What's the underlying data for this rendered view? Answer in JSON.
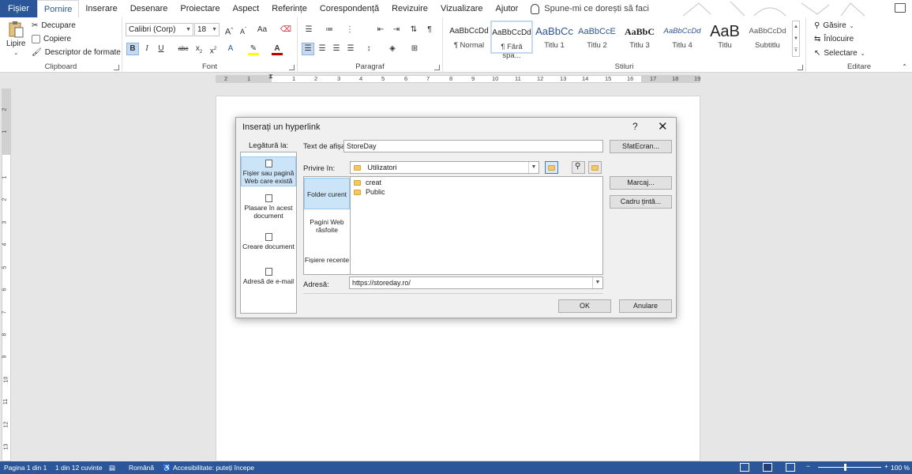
{
  "tabs": [
    "Fișier",
    "Pornire",
    "Inserare",
    "Desenare",
    "Proiectare",
    "Aspect",
    "Referințe",
    "Corespondență",
    "Revizuire",
    "Vizualizare",
    "Ajutor"
  ],
  "tell_me": "Spune-mi ce dorești să faci",
  "clipboard": {
    "paste": "Lipire",
    "cut": "Decupare",
    "copy": "Copiere",
    "format_painter": "Descriptor de formate",
    "label": "Clipboard"
  },
  "font": {
    "name": "Calibri (Corp)",
    "size": "18",
    "label": "Font",
    "case_button": "Aa",
    "grow": "A",
    "shrink": "A"
  },
  "paragraph": {
    "label": "Paragraf"
  },
  "styles": {
    "label": "Stiluri",
    "items": [
      {
        "preview": "AaBbCcDd",
        "name": "¶ Normal"
      },
      {
        "preview": "AaBbCcDd",
        "name": "¶ Fără spa..."
      },
      {
        "preview": "AaBbCc",
        "name": "Titlu 1"
      },
      {
        "preview": "AaBbCcE",
        "name": "Titlu 2"
      },
      {
        "preview": "AaBbC",
        "name": "Titlu 3"
      },
      {
        "preview": "AaBbCcDd",
        "name": "Titlu 4"
      },
      {
        "preview": "AaB",
        "name": "Titlu"
      },
      {
        "preview": "AaBbCcDd",
        "name": "Subtitlu"
      }
    ]
  },
  "editing": {
    "label": "Editare",
    "find": "Găsire",
    "replace": "Înlocuire",
    "select": "Selectare"
  },
  "ruler": {
    "h_ticks": [
      "2",
      "1",
      "1",
      "2",
      "3",
      "4",
      "5",
      "6",
      "7",
      "8",
      "9",
      "10",
      "11",
      "12",
      "13",
      "14",
      "15",
      "16",
      "17",
      "18",
      "19"
    ],
    "v_ticks": [
      "2",
      "1",
      "1",
      "2",
      "3",
      "4",
      "5",
      "6",
      "7",
      "8",
      "9",
      "10",
      "11",
      "12",
      "13"
    ]
  },
  "dialog": {
    "title": "Inserați un hyperlink",
    "help": "?",
    "close": "✕",
    "link_to_label": "Legătură la:",
    "link_to": [
      "Fișier sau pagină Web care există",
      "Plasare în acest document",
      "Creare document",
      "Adresă de e-mail"
    ],
    "text_to_display_label": "Text de afișat:",
    "text_to_display_value": "StoreDay",
    "screentip": "SfatEcran...",
    "look_in_label": "Privire în:",
    "look_in_value": "Utilizatori",
    "nav": [
      "Folder curent",
      "Pagini Web răsfoite",
      "Fișiere recente"
    ],
    "files": [
      "creat",
      "Public"
    ],
    "bookmark": "Marcaj...",
    "target_frame": "Cadru țintă...",
    "address_label": "Adresă:",
    "address_value": "https://storeday.ro/",
    "ok": "OK",
    "cancel": "Anulare"
  },
  "status": {
    "page": "Pagina 1 din 1",
    "words": "1 din 12 cuvinte",
    "language": "Română",
    "accessibility": "Accesibilitate: puteți începe",
    "zoom": "100 %"
  },
  "colors": {
    "accent": "#2b579a",
    "highlight": "#ffff00",
    "font_color": "#c00000",
    "selected": "#cce4f7"
  }
}
